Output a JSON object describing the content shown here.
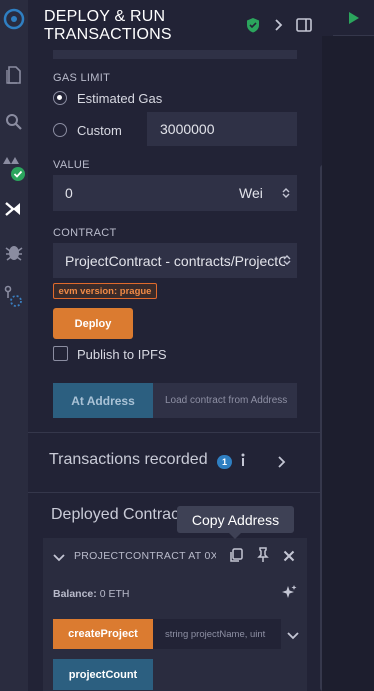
{
  "sidebar_icons": [
    "remix-logo-icon",
    "file-explorer-icon",
    "search-icon",
    "solidity-compiler-icon",
    "deploy-run-icon",
    "debugger-icon",
    "git-icon"
  ],
  "header": {
    "title": "DEPLOY & RUN TRANSACTIONS"
  },
  "gas_limit": {
    "label": "GAS LIMIT",
    "estimated_label": "Estimated Gas",
    "custom_label": "Custom",
    "custom_value": "3000000"
  },
  "value": {
    "label": "VALUE",
    "amount": "0",
    "unit": "Wei"
  },
  "contract": {
    "label": "CONTRACT",
    "selected": "ProjectContract - contracts/ProjectC",
    "evm_badge": "evm version: prague"
  },
  "deploy": {
    "button": "Deploy",
    "publish_label": "Publish to IPFS"
  },
  "at_address": {
    "button": "At Address",
    "placeholder": "Load contract from Address"
  },
  "transactions": {
    "label": "Transactions recorded",
    "count": "1"
  },
  "deployed": {
    "label": "Deployed Contrac",
    "tooltip": "Copy Address",
    "instance_title": "PROJECTCONTRACT AT 0X",
    "balance_label": "Balance:",
    "balance_value": "0 ETH",
    "functions": [
      {
        "name": "createProject",
        "placeholder": "string projectName, uint"
      },
      {
        "name": "projectCount"
      }
    ]
  },
  "colors": {
    "deploy": "#db7b30",
    "call": "#2c5f80",
    "badge": "#2f7fc2",
    "evm_badge": "#e06a2c"
  }
}
